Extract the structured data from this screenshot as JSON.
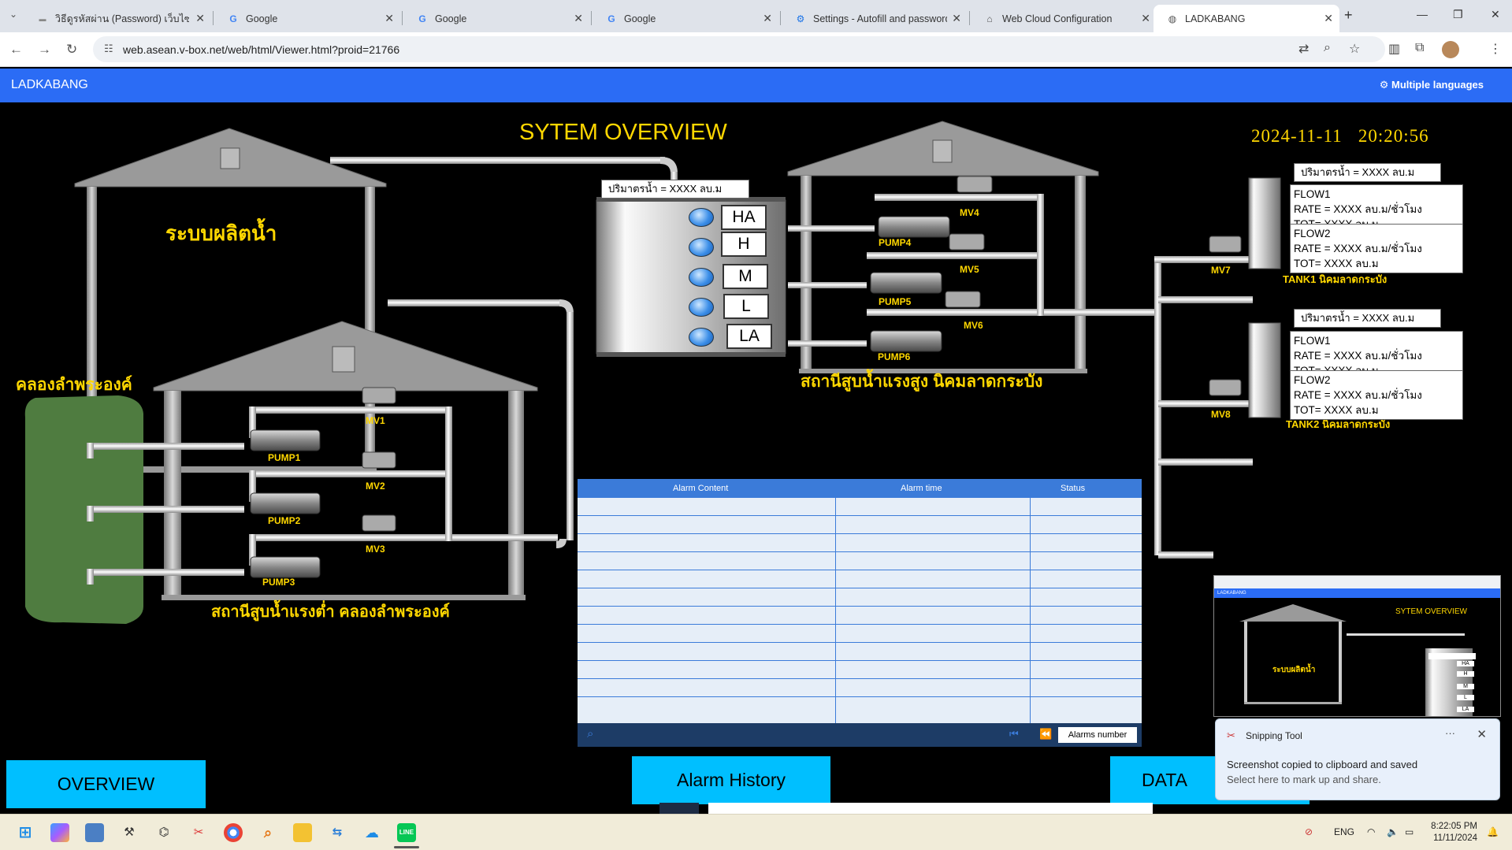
{
  "browser": {
    "tabs": [
      {
        "title": "วิธีดูรหัสผ่าน (Password) เว็บไซต์ที่บ",
        "icon": "line-today-icon"
      },
      {
        "title": "Google",
        "icon": "google-icon"
      },
      {
        "title": "Google",
        "icon": "google-icon"
      },
      {
        "title": "Google",
        "icon": "google-icon"
      },
      {
        "title": "Settings - Autofill and passwords",
        "icon": "settings-icon"
      },
      {
        "title": "Web Cloud Configuration",
        "icon": "home-icon"
      },
      {
        "title": "LADKABANG",
        "icon": "globe-icon",
        "active": true
      }
    ],
    "url": "web.asean.v-box.net/web/html/Viewer.html?proid=21766"
  },
  "app": {
    "brand": "LADKABANG",
    "language_label": "Multiple languages"
  },
  "scada": {
    "title": "SYTEM OVERVIEW",
    "date": "2024-11-11",
    "time": "20:20:56",
    "production_label": "ระบบผลิตน้ำ",
    "canal_label": "คลองลำพระองค์",
    "low_station_label": "สถานีสูบน้ำแรงต่ำ คลองลำพระองค์",
    "high_station_label": "สถานีสูบน้ำแรงสูง นิคมลาดกระบัง",
    "reservoir_volume": "ปริมาตรน้ำ =  XXXX ลบ.ม",
    "levels": [
      "HA",
      "H",
      "M",
      "L",
      "LA"
    ],
    "low_pumps": [
      "PUMP1",
      "PUMP2",
      "PUMP3"
    ],
    "low_valves": [
      "MV1",
      "MV2",
      "MV3"
    ],
    "high_pumps": [
      "PUMP4",
      "PUMP5",
      "PUMP6"
    ],
    "high_valves": [
      "MV4",
      "MV5",
      "MV6"
    ],
    "tanks": [
      {
        "name": "TANK1 นิคมลาดกระบัง",
        "valve": "MV7",
        "volume": "ปริมาตรน้ำ =  XXXX ลบ.ม",
        "flows": [
          {
            "name": "FLOW1",
            "rate": "RATE =  XXXX ลบ.ม/ชั่วโมง",
            "tot": "TOT=  XXXX ลบ.ม"
          },
          {
            "name": "FLOW2",
            "rate": "RATE =  XXXX ลบ.ม/ชั่วโมง",
            "tot": "TOT=  XXXX ลบ.ม"
          }
        ]
      },
      {
        "name": "TANK2 นิคมลาดกระบัง",
        "valve": "MV8",
        "volume": "ปริมาตรน้ำ =  XXXX ลบ.ม",
        "flows": [
          {
            "name": "FLOW1",
            "rate": "RATE =  XXXX ลบ.ม/ชั่วโมง",
            "tot": "TOT=  XXXX ลบ.ม"
          },
          {
            "name": "FLOW2",
            "rate": "RATE =  XXXX ลบ.ม/ชั่วโมง",
            "tot": "TOT=  XXXX ลบ.ม"
          }
        ]
      }
    ]
  },
  "alarm": {
    "columns": [
      "Alarm Content",
      "Alarm time",
      "Status"
    ],
    "number_label": "Alarms number"
  },
  "buttons": {
    "overview": "OVERVIEW",
    "alarm_history": "Alarm History",
    "data": "DATA"
  },
  "preview": {
    "brand": "LADKABANG",
    "title": "SYTEM OVERVIEW",
    "production_label": "ระบบผลิตน้ำ",
    "levels": [
      "HA",
      "H",
      "M",
      "L",
      "LA"
    ]
  },
  "toast": {
    "app": "Snipping Tool",
    "message": "Screenshot copied to clipboard and saved",
    "sub": "Select here to mark up and share."
  },
  "taskbar": {
    "language": "ENG",
    "time": "8:22:05 PM",
    "date": "11/11/2024"
  },
  "colors": {
    "accent": "#2b6cf5",
    "label_yellow": "#ffd700",
    "button_cyan": "#00bfff",
    "canal_green": "#4f7c40"
  }
}
